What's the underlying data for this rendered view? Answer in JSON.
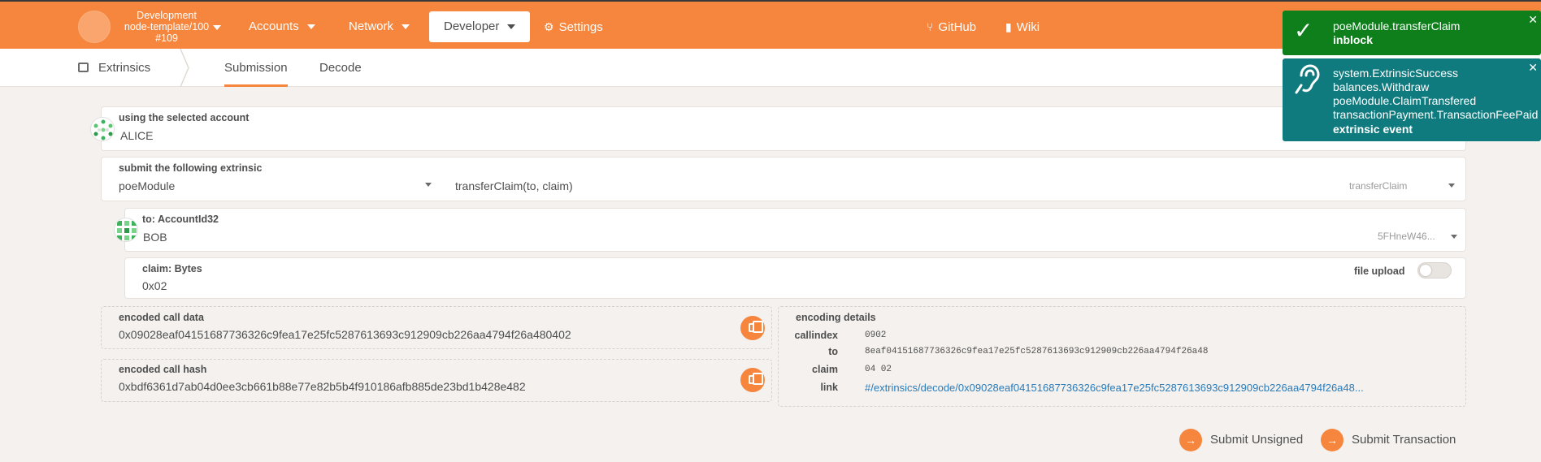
{
  "header": {
    "chain_name": "Development",
    "chain_runtime": "node-template/100",
    "chain_block": "#109",
    "nav": {
      "accounts": "Accounts",
      "network": "Network",
      "developer": "Developer",
      "settings": "Settings",
      "github": "GitHub",
      "wiki": "Wiki"
    }
  },
  "subnav": {
    "section": "Extrinsics",
    "tabs": [
      "Submission",
      "Decode"
    ],
    "active_tab": "Submission"
  },
  "account": {
    "label": "using the selected account",
    "value": "ALICE"
  },
  "extrinsic": {
    "label": "submit the following extrinsic",
    "module": "poeModule",
    "call": "transferClaim(to, claim)",
    "call_short": "transferClaim"
  },
  "param_to": {
    "label": "to: AccountId32",
    "value": "BOB",
    "address_short": "5FHneW46..."
  },
  "param_claim": {
    "label": "claim: Bytes",
    "value": "0x02",
    "file_upload_label": "file upload",
    "file_upload_enabled": false
  },
  "encoded_call_data": {
    "label": "encoded call data",
    "value": "0x09028eaf04151687736326c9fea17e25fc5287613693c912909cb226aa4794f26a480402"
  },
  "encoded_call_hash": {
    "label": "encoded call hash",
    "value": "0xbdf6361d7ab04d0ee3cb661b88e77e82b5b4f910186afb885de23bd1b428e482"
  },
  "encoding_details": {
    "label": "encoding details",
    "rows": [
      {
        "key": "callindex",
        "value": "0902"
      },
      {
        "key": "to",
        "value": "8eaf04151687736326c9fea17e25fc5287613693c912909cb226aa4794f26a48"
      },
      {
        "key": "claim",
        "value": "04 02"
      },
      {
        "key": "link",
        "value": "#/extrinsics/decode/0x09028eaf04151687736326c9fea17e25fc5287613693c912909cb226aa4794f26a48..."
      }
    ]
  },
  "actions": {
    "submit_unsigned": "Submit Unsigned",
    "submit_transaction": "Submit Transaction"
  },
  "notifications": [
    {
      "lines": [
        "poeModule.transferClaim"
      ],
      "status": "inblock",
      "color": "#0e7f1b",
      "icon": "check-icon"
    },
    {
      "lines": [
        "system.ExtrinsicSuccess",
        "balances.Withdraw",
        "poeModule.ClaimTransfered",
        "transactionPayment.TransactionFeePaid"
      ],
      "status": "extrinsic event",
      "color": "#107b7f",
      "icon": "listening-icon"
    }
  ],
  "colors": {
    "accent": "#f6863d",
    "background": "#f4f1ee",
    "link": "#2b7bb9"
  }
}
